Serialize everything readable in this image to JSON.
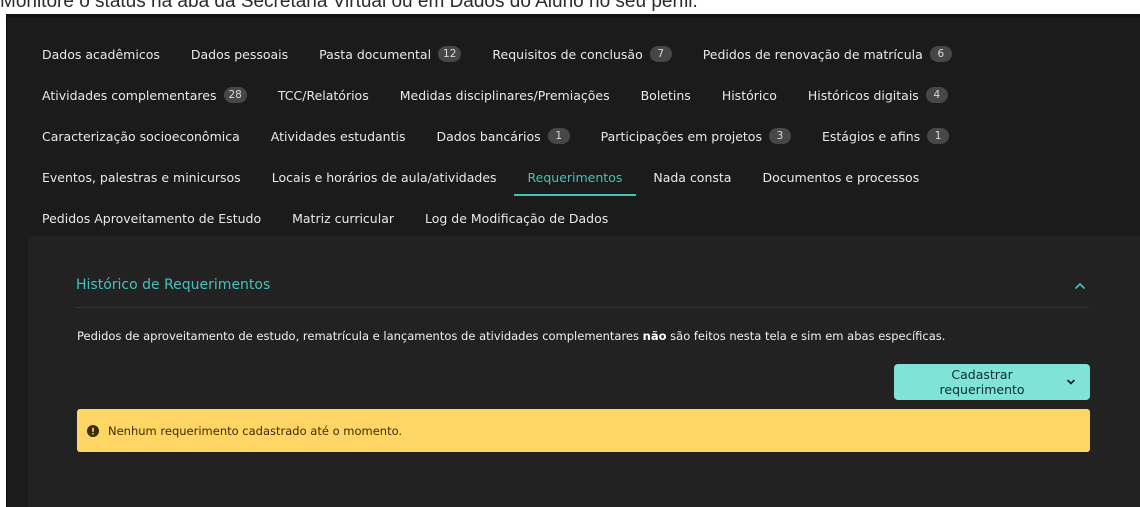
{
  "caption": "Monitore o status na aba da Secretaria Virtual ou em Dados do Aluno no seu perfil.",
  "tabs": {
    "row1": [
      {
        "label": "Dados acadêmicos"
      },
      {
        "label": "Dados pessoais"
      },
      {
        "label": "Pasta documental",
        "badge": "12"
      },
      {
        "label": "Requisitos de conclusão",
        "badge": "7"
      },
      {
        "label": "Pedidos de renovação de matrícula",
        "badge": "6"
      }
    ],
    "row2": [
      {
        "label": "Atividades complementares",
        "badge": "28"
      },
      {
        "label": "TCC/Relatórios"
      },
      {
        "label": "Medidas disciplinares/Premiações"
      },
      {
        "label": "Boletins"
      },
      {
        "label": "Histórico"
      },
      {
        "label": "Históricos digitais",
        "badge": "4"
      }
    ],
    "row3": [
      {
        "label": "Caracterização socioeconômica"
      },
      {
        "label": "Atividades estudantis"
      },
      {
        "label": "Dados bancários",
        "badge": "1"
      },
      {
        "label": "Participações em projetos",
        "badge": "3"
      },
      {
        "label": "Estágios e afins",
        "badge": "1"
      }
    ],
    "row4": [
      {
        "label": "Eventos, palestras e minicursos"
      },
      {
        "label": "Locais e horários de aula/atividades"
      },
      {
        "label": "Requerimentos",
        "active": true
      },
      {
        "label": "Nada consta"
      },
      {
        "label": "Documentos e processos"
      }
    ],
    "row5": [
      {
        "label": "Pedidos Aproveitamento de Estudo"
      },
      {
        "label": "Matriz curricular"
      },
      {
        "label": "Log de Modificação de Dados"
      }
    ]
  },
  "panel": {
    "title": "Histórico de Requerimentos",
    "notice_before": "Pedidos de aproveitamento de estudo, rematrícula e lançamentos de atividades complementares ",
    "notice_bold": "não",
    "notice_after": " são feitos nesta tela e sim em abas específicas.",
    "button_label": "Cadastrar requerimento",
    "alert_text": "Nenhum requerimento cadastrado até o momento."
  },
  "colors": {
    "accent": "#45c2bd",
    "button_bg": "#7fe3d7",
    "alert_bg": "#ffd666",
    "page_bg": "#1b1b1b"
  }
}
